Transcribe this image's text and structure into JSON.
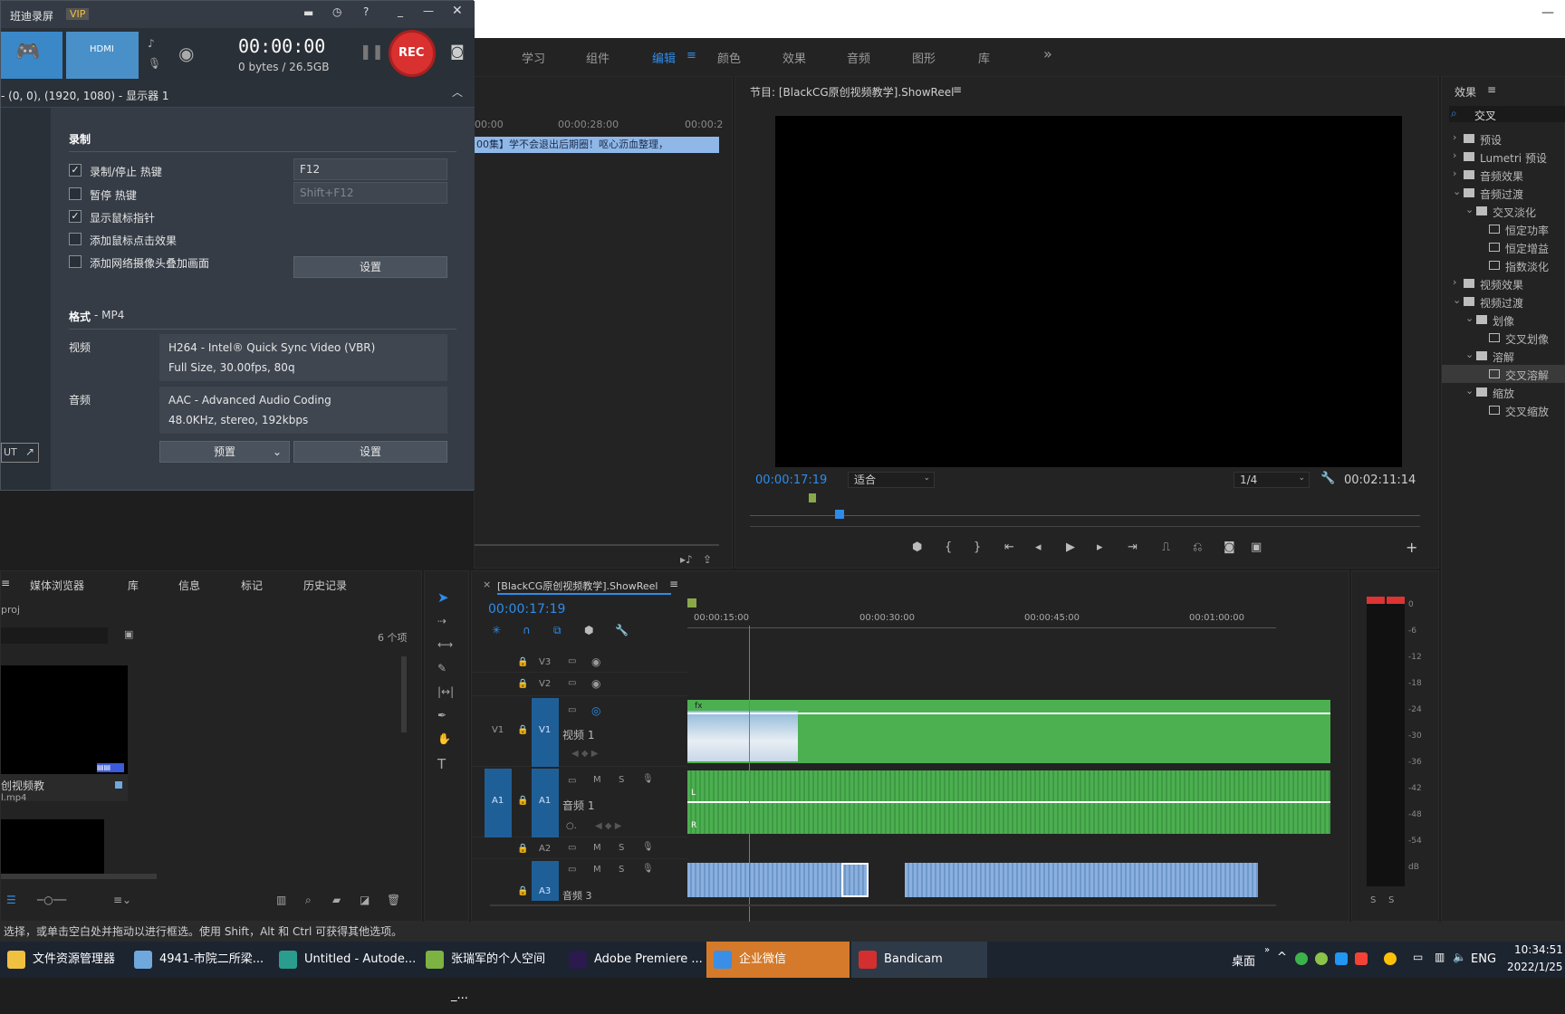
{
  "premiere": {
    "workspace_tabs": [
      "学习",
      "组件",
      "编辑",
      "颜色",
      "效果",
      "音频",
      "图形",
      "库"
    ],
    "active_tab": "编辑",
    "more_label": "»",
    "source_ruler": {
      "t1": "00:00",
      "t2": "00:00:28:00",
      "t3": "00:00:2"
    },
    "source_clip_text": "00集】学不会退出后期圈！呕心沥血整理，",
    "program": {
      "title": "节目: [BlackCG原创视频教学].ShowReel",
      "timecode": "00:00:17:19",
      "fit": "适合",
      "quality": "1/4",
      "duration": "00:02:11:14"
    },
    "effects": {
      "title": "效果",
      "search": "交叉",
      "tree": [
        {
          "label": "预设",
          "level": 0,
          "arrow": "›",
          "type": "folder"
        },
        {
          "label": "Lumetri 预设",
          "level": 0,
          "arrow": "›",
          "type": "folder"
        },
        {
          "label": "音频效果",
          "level": 0,
          "arrow": "›",
          "type": "folder"
        },
        {
          "label": "音频过渡",
          "level": 0,
          "arrow": "⌄",
          "type": "folder"
        },
        {
          "label": "交叉淡化",
          "level": 1,
          "arrow": "⌄",
          "type": "folder"
        },
        {
          "label": "恒定功率",
          "level": 2,
          "arrow": "",
          "type": "fx"
        },
        {
          "label": "恒定增益",
          "level": 2,
          "arrow": "",
          "type": "fx"
        },
        {
          "label": "指数淡化",
          "level": 2,
          "arrow": "",
          "type": "fx"
        },
        {
          "label": "视频效果",
          "level": 0,
          "arrow": "›",
          "type": "folder"
        },
        {
          "label": "视频过渡",
          "level": 0,
          "arrow": "⌄",
          "type": "folder"
        },
        {
          "label": "划像",
          "level": 1,
          "arrow": "⌄",
          "type": "folder"
        },
        {
          "label": "交叉划像",
          "level": 2,
          "arrow": "",
          "type": "fx"
        },
        {
          "label": "溶解",
          "level": 1,
          "arrow": "⌄",
          "type": "folder"
        },
        {
          "label": "交叉溶解",
          "level": 2,
          "arrow": "",
          "type": "fx",
          "selected": true
        },
        {
          "label": "缩放",
          "level": 1,
          "arrow": "⌄",
          "type": "folder"
        },
        {
          "label": "交叉缩放",
          "level": 2,
          "arrow": "",
          "type": "fx"
        }
      ]
    },
    "project": {
      "tabs": [
        "媒体浏览器",
        "库",
        "信息",
        "标记",
        "历史记录"
      ],
      "proj_name": "proj",
      "count": "6 个项",
      "item1_name": "创视频教",
      "item1_file": "l.mp4"
    },
    "timeline": {
      "title": "[BlackCG原创视频教学].ShowReel",
      "timecode": "00:00:17:19",
      "ruler": [
        "00:00:15:00",
        "00:00:30:00",
        "00:00:45:00",
        "00:01:00:00"
      ],
      "tracks": [
        {
          "src": "",
          "name": "V3",
          "label": ""
        },
        {
          "src": "",
          "name": "V2",
          "label": ""
        },
        {
          "src": "V1",
          "name": "V1",
          "label": "视频 1"
        },
        {
          "src": "A1",
          "name": "A1",
          "label": "音频 1"
        },
        {
          "src": "",
          "name": "A2",
          "label": ""
        },
        {
          "src": "",
          "name": "A3",
          "label": "音频 3"
        }
      ],
      "m_label": "M",
      "s_label": "S"
    },
    "meter": {
      "scale": [
        "0",
        "-6",
        "-12",
        "-18",
        "-24",
        "-30",
        "-36",
        "-42",
        "-48",
        "-54",
        "dB"
      ],
      "solo": [
        "S",
        "S"
      ]
    }
  },
  "bandicam": {
    "title": "班迪录屏",
    "vip": "VIP",
    "timer": "00:00:00",
    "size": "0 bytes / 26.5GB",
    "rec": "REC",
    "display": "- (0, 0), (1920, 1080) - 显示器 1",
    "section_record": "录制",
    "options": [
      {
        "label": "录制/停止 热键",
        "checked": true
      },
      {
        "label": "暂停 热键",
        "checked": false
      },
      {
        "label": "显示鼠标指针",
        "checked": true
      },
      {
        "label": "添加鼠标点击效果",
        "checked": false
      },
      {
        "label": "添加网络摄像头叠加画面",
        "checked": false
      }
    ],
    "hotkey1": "F12",
    "hotkey2": "Shift+F12",
    "settings": "设置",
    "format_label": "格式",
    "format_value": " - MP4",
    "video_label": "视频",
    "video_line1": "H264 - Intel® Quick Sync Video (VBR)",
    "video_line2": "Full Size, 30.00fps, 80q",
    "audio_label": "音频",
    "audio_line1": "AAC - Advanced Audio Coding",
    "audio_line2": "48.0KHz, stereo, 192kbps",
    "preset": "预置",
    "side_btn": "UT"
  },
  "status_text": "选择，或单击空白处并拖动以进行框选。使用 Shift，Alt 和 Ctrl 可获得其他选项。",
  "taskbar": {
    "items": [
      {
        "label": "文件资源管理器",
        "color": "#f0c040"
      },
      {
        "label": "4941-市院二所梁...",
        "color": "#6fa8dc"
      },
      {
        "label": "Untitled - Autode...",
        "color": "#2a9d8f"
      },
      {
        "label": "张瑞军的个人空间_...",
        "color": "#7cb342"
      },
      {
        "label": "Adobe Premiere ...",
        "color": "#2b1a4d"
      },
      {
        "label": "企业微信",
        "color": "#3a8ee6"
      },
      {
        "label": "Bandicam",
        "color": "#d32f2f"
      }
    ],
    "desktop": "桌面",
    "lang": "ENG",
    "time": "10:34:51",
    "date": "2022/1/25"
  }
}
